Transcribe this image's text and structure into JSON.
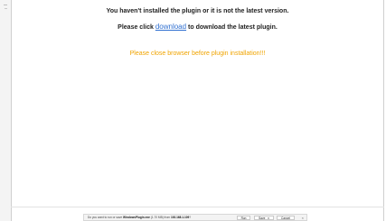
{
  "message": {
    "line1": "You haven't installed the plugin or it is not the latest version.",
    "line2_prefix": "Please click",
    "line2_link": "download",
    "line2_suffix": "to download the latest plugin.",
    "warning": "Please close browser before plugin installation!!!"
  },
  "download_bar": {
    "prefix": "Do you want to run or save",
    "file": "WindowsPlugin.exe",
    "size_and_from": "(1.70 MB) from",
    "host": "192.168.1.109",
    "suffix": "?",
    "run_label": "Run",
    "save_label": "Save",
    "cancel_label": "Cancel",
    "close_glyph": "×"
  },
  "colors": {
    "link": "#2f6fd0",
    "warning": "#f0a400"
  }
}
